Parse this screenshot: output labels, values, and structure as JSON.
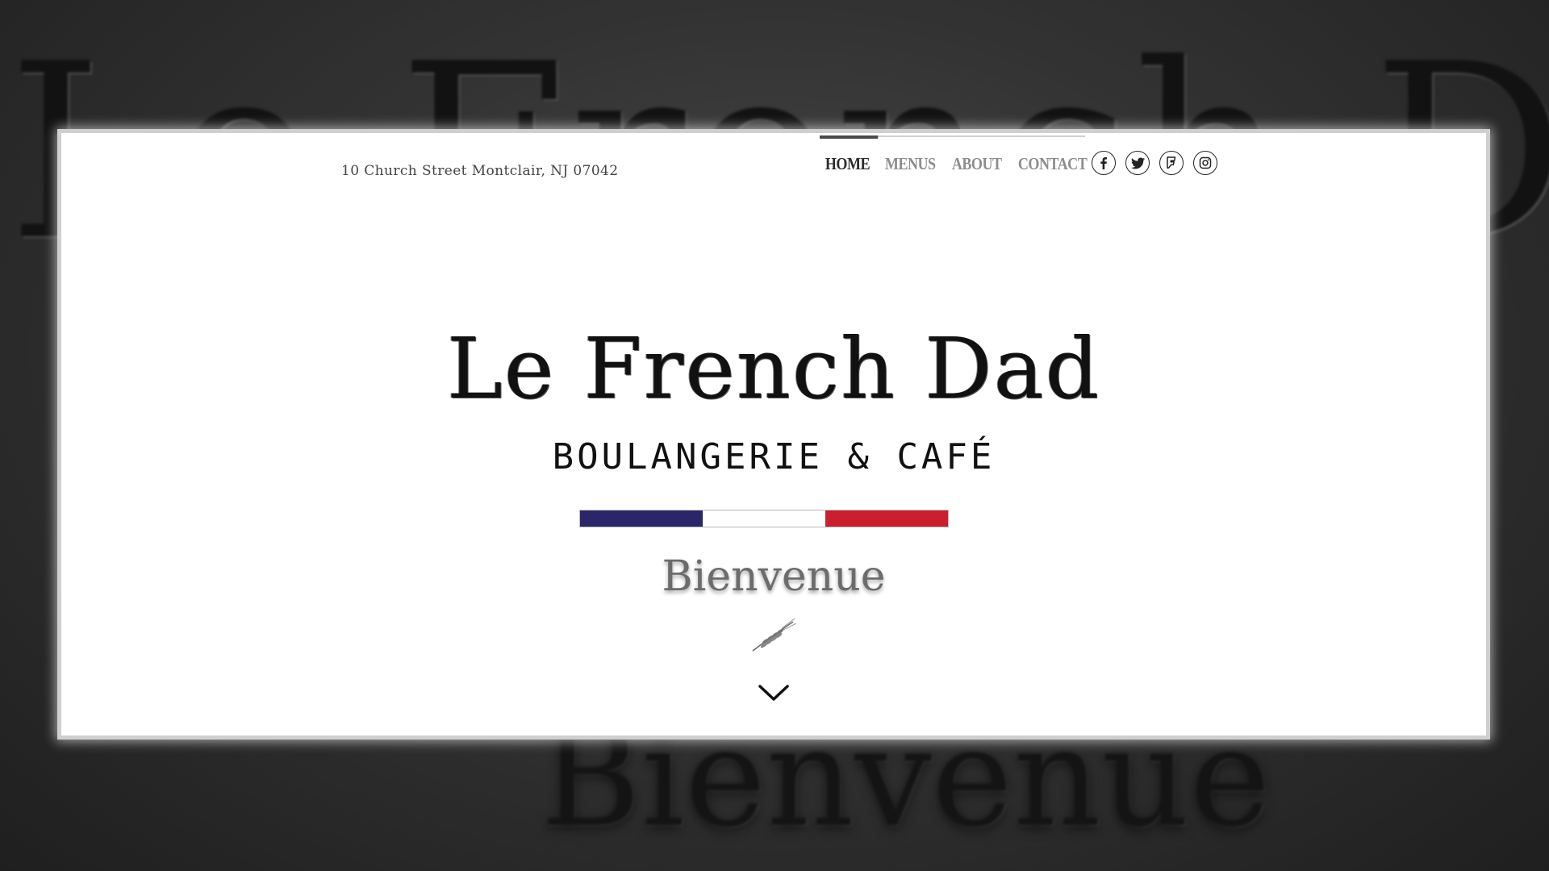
{
  "background": {
    "title_text": "Le French Dad",
    "bienvenue_text": "Bienvenue"
  },
  "header": {
    "address": "10 Church Street Montclair, NJ 07042",
    "nav": [
      {
        "label": "HOME",
        "active": true
      },
      {
        "label": "MENUS",
        "active": false
      },
      {
        "label": "ABOUT",
        "active": false
      },
      {
        "label": "CONTACT",
        "active": false
      }
    ],
    "socials": [
      "facebook-icon",
      "twitter-icon",
      "foursquare-icon",
      "instagram-icon"
    ]
  },
  "hero": {
    "title": "Le French Dad",
    "subtitle": "BOULANGERIE & CAFÉ",
    "flag_colors": [
      "#2a2668",
      "#ffffff",
      "#c91f2e"
    ],
    "welcome": "Bienvenue",
    "ornament_icon": "wheat-icon",
    "scroll_icon": "chevron-down-icon"
  }
}
